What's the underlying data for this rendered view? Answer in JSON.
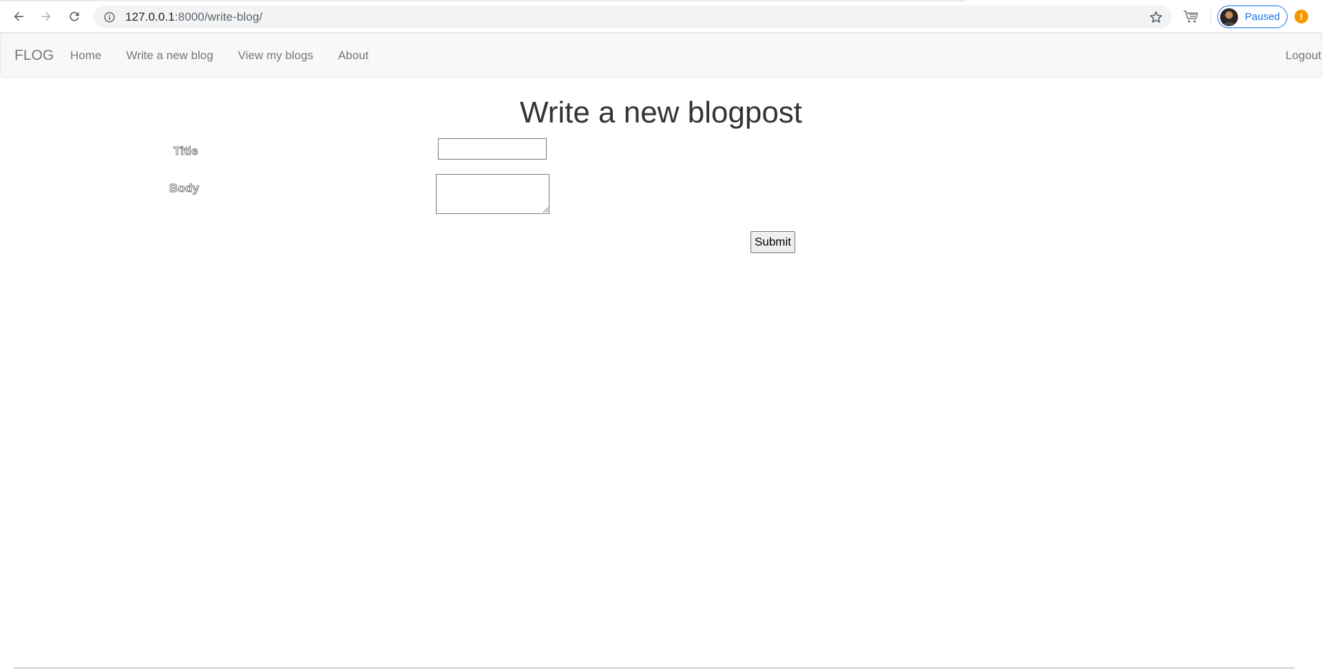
{
  "browser": {
    "url_host": "127.0.0.1",
    "url_rest": ":8000/write-blog/",
    "profile_status": "Paused",
    "alert_symbol": "!",
    "icons": {
      "back": "arrow-left-icon",
      "forward": "arrow-right-icon",
      "reload": "reload-icon",
      "site_info": "info-icon",
      "bookmark": "star-icon",
      "extension": "cart-icon",
      "alert": "exclamation-circle-icon"
    },
    "accent_color": "#1a73e8",
    "alert_color": "#f29900"
  },
  "navbar": {
    "brand": "FLOG",
    "links": [
      "Home",
      "Write a new blog",
      "View my blogs",
      "About"
    ],
    "logout": "Logout"
  },
  "main": {
    "heading": "Write a new blogpost",
    "form": {
      "title_label": "Title",
      "title_value": "",
      "body_label": "Body",
      "body_value": "",
      "submit_label": "Submit"
    }
  }
}
